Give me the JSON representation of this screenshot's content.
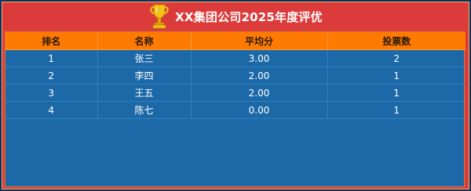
{
  "header": {
    "title": "XX集团公司2025年度评优",
    "trophy_icon": "trophy-icon"
  },
  "table": {
    "columns": [
      "排名",
      "名称",
      "平均分",
      "投票数"
    ],
    "rows": [
      [
        "1",
        "张三",
        "3.00",
        "2"
      ],
      [
        "2",
        "李四",
        "2.00",
        "1"
      ],
      [
        "3",
        "王五",
        "2.00",
        "1"
      ],
      [
        "4",
        "陈七",
        "0.00",
        "1"
      ]
    ]
  },
  "colors": {
    "page_background": "#0d2f63",
    "panel_red": "#dc3b3b",
    "header_orange": "#ff7a00",
    "table_blue": "#1d69a7"
  }
}
